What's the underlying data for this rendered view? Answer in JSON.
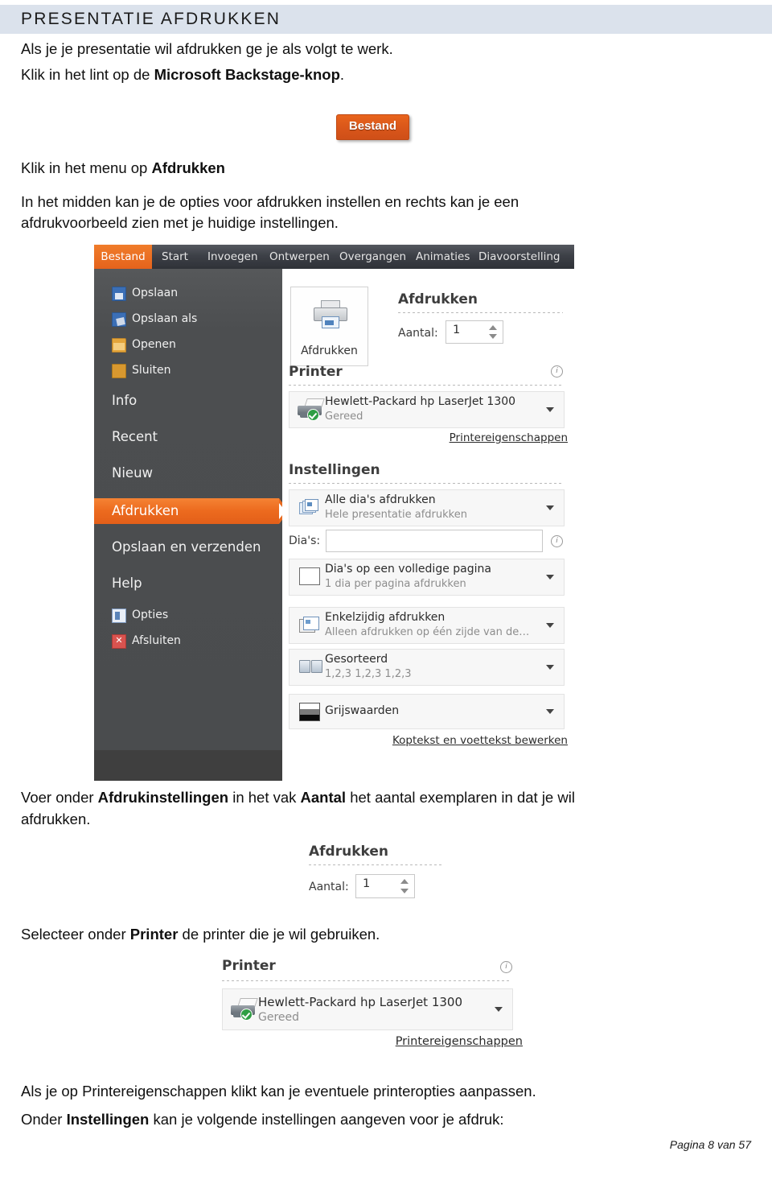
{
  "header": {
    "title": "PRESENTATIE AFDRUKKEN",
    "band_color": "#dbe2ec"
  },
  "intro": {
    "line1": "Als je je presentatie wil afdrukken ge je als volgt te werk.",
    "line2_prefix": "Klik in het lint op de ",
    "line2_bold": "Microsoft Backstage-knop",
    "line2_suffix": "."
  },
  "bestand_button": {
    "label": "Bestand",
    "color": "#d9561a"
  },
  "step2": {
    "line_prefix": "Klik in het menu op ",
    "line_bold": "Afdrukken",
    "body_line1": "In het midden kan je de opties voor afdrukken instellen en rechts kan je een",
    "body_line2": "afdrukvoorbeeld zien met je huidige instellingen."
  },
  "screenshot": {
    "ribbon_tabs": [
      {
        "label": "Bestand",
        "active": true
      },
      {
        "label": "Start",
        "active": false
      },
      {
        "label": "Invoegen",
        "active": false
      },
      {
        "label": "Ontwerpen",
        "active": false
      },
      {
        "label": "Overgangen",
        "active": false
      },
      {
        "label": "Animaties",
        "active": false
      },
      {
        "label": "Diavoorstelling",
        "active": false
      }
    ],
    "backstage_menu": [
      {
        "label": "Opslaan",
        "icon": "save-icon",
        "selected": false,
        "big": false
      },
      {
        "label": "Opslaan als",
        "icon": "save-as-icon",
        "selected": false,
        "big": false
      },
      {
        "label": "Openen",
        "icon": "open-folder-icon",
        "selected": false,
        "big": false
      },
      {
        "label": "Sluiten",
        "icon": "close-folder-icon",
        "selected": false,
        "big": false
      },
      {
        "label": "Info",
        "icon": "",
        "selected": false,
        "big": true
      },
      {
        "label": "Recent",
        "icon": "",
        "selected": false,
        "big": true
      },
      {
        "label": "Nieuw",
        "icon": "",
        "selected": false,
        "big": true
      },
      {
        "label": "Afdrukken",
        "icon": "",
        "selected": true,
        "big": true
      },
      {
        "label": "Opslaan en verzenden",
        "icon": "",
        "selected": false,
        "big": true
      },
      {
        "label": "Help",
        "icon": "",
        "selected": false,
        "big": true
      },
      {
        "label": "Opties",
        "icon": "options-icon",
        "selected": false,
        "big": false
      },
      {
        "label": "Afsluiten",
        "icon": "exit-icon",
        "selected": false,
        "big": false
      }
    ],
    "print_button_label": "Afdrukken",
    "afdrukken_heading": "Afdrukken",
    "aantal_label": "Aantal:",
    "aantal_value": "1",
    "printer_heading": "Printer",
    "printer_name": "Hewlett-Packard hp LaserJet 1300",
    "printer_status": "Gereed",
    "printer_properties_link": "Printereigenschappen",
    "instellingen_heading": "Instellingen",
    "settings": [
      {
        "main": "Alle dia's afdrukken",
        "sub": "Hele presentatie afdrukken",
        "icon": "slides-stack-icon"
      },
      {
        "main": "Dia's op een volledige pagina",
        "sub": "1 dia per pagina afdrukken",
        "icon": "full-page-icon"
      },
      {
        "main": "Enkelzijdig afdrukken",
        "sub": "Alleen afdrukken op één zijde van de…",
        "icon": "single-sided-icon"
      },
      {
        "main": "Gesorteerd",
        "sub": "1,2,3   1,2,3   1,2,3",
        "icon": "collate-icon"
      },
      {
        "main": "Grijswaarden",
        "sub": "",
        "icon": "grayscale-icon"
      }
    ],
    "dias_label": "Dia's:",
    "dias_value": "",
    "header_footer_link": "Koptekst en voettekst bewerken"
  },
  "step3": {
    "prefix": "Voer onder ",
    "bold1": "Afdrukinstellingen",
    "mid": " in het vak ",
    "bold2": "Aantal",
    "suffix": " het aantal exemplaren in dat je wil",
    "line2": "afdrukken."
  },
  "crop_count": {
    "heading": "Afdrukken",
    "label": "Aantal:",
    "value": "1"
  },
  "step4": {
    "prefix": "Selecteer onder ",
    "bold": "Printer",
    "suffix": " de printer die je wil gebruiken."
  },
  "crop_printer": {
    "heading": "Printer",
    "name": "Hewlett-Packard hp LaserJet 1300",
    "status": "Gereed",
    "properties_link": "Printereigenschappen"
  },
  "step5": {
    "line1": "Als je op Printereigenschappen klikt kan je eventuele printeropties aanpassen.",
    "line2_prefix": "Onder ",
    "line2_bold": "Instellingen",
    "line2_suffix": " kan je volgende instellingen aangeven voor je afdruk:"
  },
  "footer": {
    "text": "Pagina 8 van 57"
  }
}
